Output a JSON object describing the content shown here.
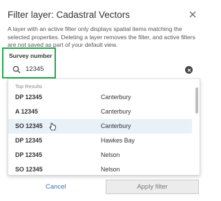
{
  "dialog": {
    "title": "Filter layer: Cadastral Vectors",
    "description": "A layer with an active filter only displays spatial items matching the selected properties. Deleting a layer removes the filter, and active filters are not saved as part of your default view."
  },
  "search": {
    "label": "Survey number",
    "value": "12345",
    "icon": "search-icon",
    "clear_icon": "clear-icon"
  },
  "results": {
    "header": "Top Results",
    "rows": [
      {
        "number": "DP 12345",
        "region": "Canterbury"
      },
      {
        "number": "A 12345",
        "region": "Canterbury"
      },
      {
        "number": "SO 12345",
        "region": "Canterbury"
      },
      {
        "number": "DP 12345",
        "region": "Hawkes Bay"
      },
      {
        "number": "DP 12345",
        "region": "Nelson"
      },
      {
        "number": "SO 12345",
        "region": "Nelson"
      }
    ],
    "hovered_index": 2
  },
  "footer": {
    "cancel_label": "Cancel",
    "apply_label": "Apply filter"
  },
  "colors": {
    "highlight": "#1fa64a",
    "link": "#3b73b9",
    "row_hover": "#e8f0f8"
  }
}
